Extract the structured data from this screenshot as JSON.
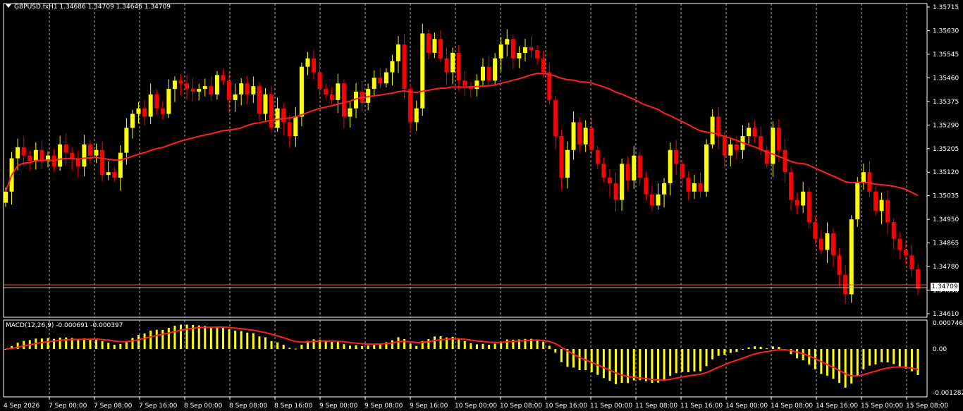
{
  "header": {
    "symbol_line": "GBPUSD.fxH1 1.34686 1.34709 1.34646 1.34709"
  },
  "macd": {
    "label": "MACD(12,26,9) -0.000691 -0.000397",
    "axis_labels": [
      "0.000746",
      "0.00",
      "-0.001282"
    ]
  },
  "current_price": "1.34709",
  "colors": {
    "background": "#000000",
    "bull": "#ffff00",
    "bear": "#ff0000",
    "ma_line": "#ff2020",
    "grid": "#ffffff",
    "axis_text": "#ffffff"
  },
  "chart_data": {
    "type": "candlestick",
    "y_ticks": [
      "1.35715",
      "1.35630",
      "1.35545",
      "1.35460",
      "1.35375",
      "1.35290",
      "1.35205",
      "1.35120",
      "1.35035",
      "1.34950",
      "1.34865",
      "1.34780",
      "1.34695",
      "1.34610"
    ],
    "ylim": [
      1.3461,
      1.35715
    ],
    "x_ticks": [
      "4 Sep 2026",
      "7 Sep 00:00",
      "7 Sep 08:00",
      "7 Sep 16:00",
      "8 Sep 00:00",
      "8 Sep 08:00",
      "8 Sep 16:00",
      "9 Sep 00:00",
      "9 Sep 08:00",
      "9 Sep 16:00",
      "10 Sep 00:00",
      "10 Sep 08:00",
      "10 Sep 16:00",
      "11 Sep 00:00",
      "11 Sep 08:00",
      "11 Sep 16:00",
      "14 Sep 00:00",
      "14 Sep 08:00",
      "14 Sep 16:00",
      "15 Sep 00:00",
      "15 Sep 08:00"
    ],
    "close_path": [
      1.3505,
      1.3517,
      1.3521,
      1.3518,
      1.3516,
      1.352,
      1.3516,
      1.3518,
      1.3514,
      1.3522,
      1.3519,
      1.3517,
      1.3514,
      1.3522,
      1.3518,
      1.352,
      1.3511,
      1.3512,
      1.351,
      1.3519,
      1.3528,
      1.3533,
      1.3535,
      1.3532,
      1.354,
      1.3535,
      1.3533,
      1.3542,
      1.3545,
      1.3544,
      1.3542,
      1.3541,
      1.3542,
      1.3543,
      1.354,
      1.3547,
      1.3545,
      1.3538,
      1.354,
      1.3544,
      1.354,
      1.3543,
      1.3533,
      1.354,
      1.3528,
      1.3535,
      1.353,
      1.3525,
      1.3532,
      1.355,
      1.3553,
      1.3548,
      1.3542,
      1.354,
      1.3538,
      1.3544,
      1.3532,
      1.3535,
      1.3541,
      1.3537,
      1.3542,
      1.3546,
      1.3544,
      1.3548,
      1.3552,
      1.3558,
      1.3542,
      1.353,
      1.3535,
      1.3562,
      1.3555,
      1.356,
      1.3553,
      1.3548,
      1.3555,
      1.3545,
      1.3543,
      1.3542,
      1.3545,
      1.355,
      1.3545,
      1.3553,
      1.3558,
      1.356,
      1.3553,
      1.3555,
      1.3557,
      1.3556,
      1.3553,
      1.3548,
      1.3538,
      1.3525,
      1.351,
      1.352,
      1.353,
      1.3522,
      1.3528,
      1.352,
      1.3515,
      1.351,
      1.3508,
      1.3502,
      1.3515,
      1.3509,
      1.3518,
      1.351,
      1.3504,
      1.35,
      1.3504,
      1.3508,
      1.352,
      1.3515,
      1.351,
      1.3505,
      1.3508,
      1.3505,
      1.3522,
      1.3532,
      1.3525,
      1.3518,
      1.3522,
      1.352,
      1.3525,
      1.3528,
      1.3525,
      1.352,
      1.3515,
      1.3528,
      1.352,
      1.3512,
      1.3502,
      1.35,
      1.3505,
      1.3494,
      1.3488,
      1.3484,
      1.349,
      1.3482,
      1.3475,
      1.3468,
      1.3495,
      1.3508,
      1.3512,
      1.3505,
      1.3498,
      1.3502,
      1.3494,
      1.3488,
      1.3484,
      1.3482,
      1.3477,
      1.347
    ]
  }
}
